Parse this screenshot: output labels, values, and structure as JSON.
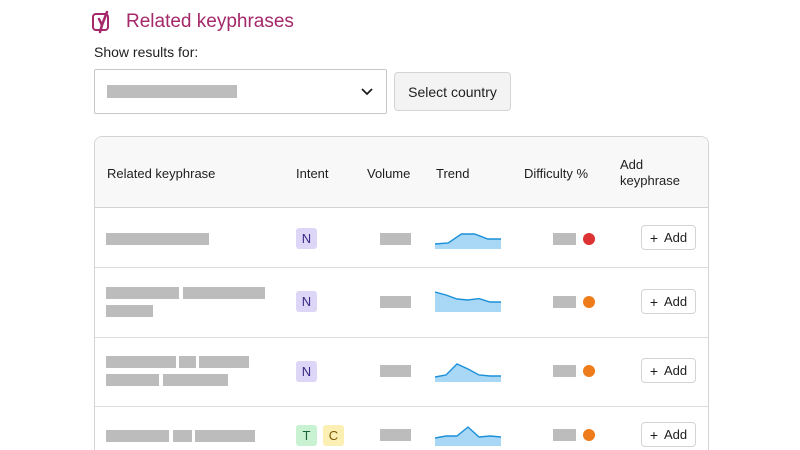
{
  "header": {
    "title": "Related keyphrases",
    "show_results_label": "Show results for:"
  },
  "controls": {
    "select_country_label": "Select country"
  },
  "table": {
    "columns": [
      "Related keyphrase",
      "Intent",
      "Volume",
      "Trend",
      "Difficulty %",
      "Add keyphrase"
    ],
    "add_label": "Add",
    "rows": [
      {
        "intents": [
          "N"
        ],
        "trend": [
          0.2,
          0.25,
          0.7,
          0.7,
          0.45,
          0.45
        ],
        "difficulty_color": "#dc3232"
      },
      {
        "intents": [
          "N"
        ],
        "trend": [
          0.95,
          0.8,
          0.6,
          0.55,
          0.62,
          0.45,
          0.45
        ],
        "difficulty_color": "#ee7c1b"
      },
      {
        "intents": [
          "N"
        ],
        "trend": [
          0.2,
          0.3,
          0.85,
          0.6,
          0.3,
          0.25,
          0.25
        ],
        "difficulty_color": "#ee7c1b"
      },
      {
        "intents": [
          "T",
          "C"
        ],
        "trend": [
          0.35,
          0.45,
          0.45,
          0.9,
          0.4,
          0.45,
          0.4
        ],
        "difficulty_color": "#ee7c1b"
      }
    ]
  },
  "colors": {
    "brand": "#a4286a",
    "trend_fill": "#a8d8f5",
    "trend_line": "#1c90d8"
  }
}
